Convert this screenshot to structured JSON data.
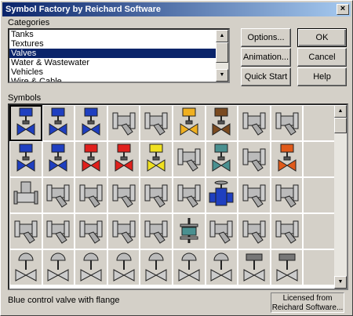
{
  "window": {
    "title": "Symbol Factory by Reichard Software",
    "close_glyph": "×"
  },
  "categories": {
    "label": "Categories",
    "items": [
      {
        "label": "Tanks",
        "selected": false
      },
      {
        "label": "Textures",
        "selected": false
      },
      {
        "label": "Valves",
        "selected": true
      },
      {
        "label": "Water & Wastewater",
        "selected": false
      },
      {
        "label": "Vehicles",
        "selected": false
      },
      {
        "label": "Wire & Cable",
        "selected": false
      }
    ]
  },
  "buttons": {
    "options": "Options...",
    "ok": "OK",
    "animation": "Animation...",
    "cancel": "Cancel",
    "quick_start": "Quick Start",
    "help": "Help"
  },
  "symbols": {
    "label": "Symbols",
    "selected_index": 0,
    "colors": {
      "blue": "#1f3fc0",
      "red": "#e0201c",
      "yellow": "#f0e020",
      "gold": "#f0b020",
      "gray": "#a8a8a8",
      "teal": "#4a9090",
      "steelblue": "#4a86c8",
      "navy": "#1a1a80",
      "orange": "#e05a1a"
    },
    "icons": [
      "blue-control-valve-icon",
      "blue-actuated-valve-icon",
      "blue-pilot-valve-icon",
      "gray-actuated-valve-icon",
      "gray-solenoid-valve-icon",
      "gold-actuator-valve-icon",
      "brown-valve-icon",
      "gray-gear-valve-icon",
      "gray-angle-valve-icon",
      "blank",
      "blue-solenoid-valve-icon",
      "blue-red-motor-valve-icon",
      "red-gear-valve-icon",
      "red-actuated-valve-icon",
      "yellow-actuated-valve-icon",
      "gray-diaphragm-valve-icon",
      "teal-globe-valve-icon",
      "gray-ball-valve-icon",
      "orange-motor-valve-icon",
      "blank",
      "steelblue-valve-icon",
      "gray-check-valve-icon",
      "gray-gate-valve-icon",
      "gray-gate-valve-tall-icon",
      "gray-tee-fitting-icon",
      "gray-gate-valve-wheel-icon",
      "blue-gate-valve-icon",
      "gray-plug-valve-icon",
      "gray-handwheel-valve-icon",
      "blank",
      "gray-flanged-y-valve-icon",
      "gray-y-strainer-icon",
      "gray-wafer-valve-icon",
      "gray-y-valve-icon",
      "gray-needle-valve-icon",
      "teal-flow-meter-icon",
      "gray-pneumatic-valve-icon",
      "blue-butterfly-valve-icon",
      "gray-pressure-valve-icon",
      "blank",
      "gray-dome-valve-icon",
      "gray-dome-valve-icon",
      "gray-dome-valve-icon",
      "gray-dome-valve-icon",
      "gray-dome-valve-icon",
      "gray-dome-valve-icon",
      "gray-dome-valve-icon",
      "gray-box-valve-icon",
      "gray-box-valve-icon",
      "blank"
    ]
  },
  "status": {
    "text": "Blue control valve with flange"
  },
  "license": {
    "line1": "Licensed from",
    "line2": "Reichard Software..."
  }
}
